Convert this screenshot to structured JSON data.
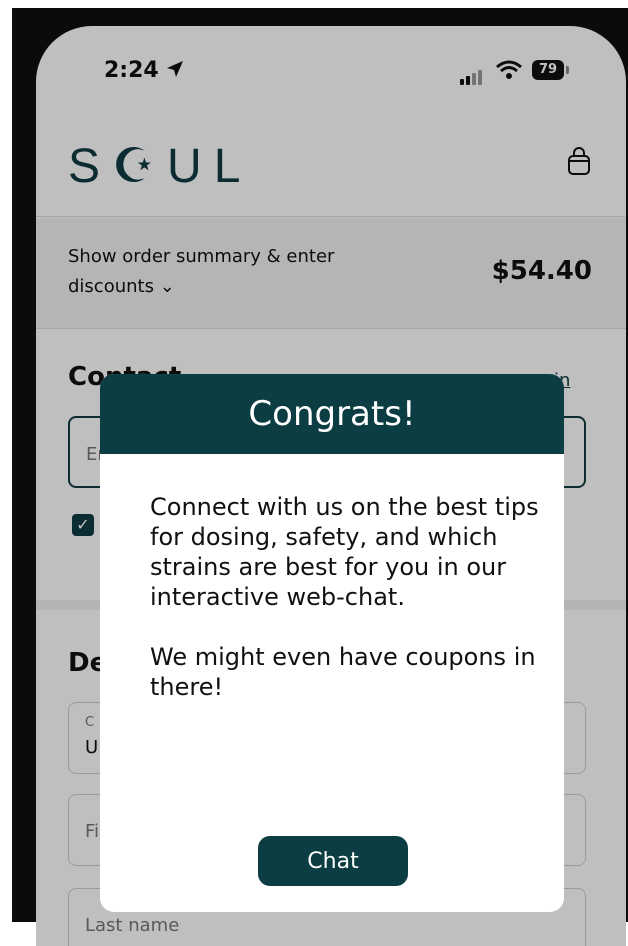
{
  "status": {
    "time": "2:24",
    "battery": "79"
  },
  "brand": {
    "logo": "S☪UL",
    "accent": "#0b3d42"
  },
  "summary": {
    "label": "Show order summary & enter discounts ⌄",
    "price": "$54.40"
  },
  "contact": {
    "heading": "Contact",
    "login_link": "in",
    "email_placeholder": "En"
  },
  "delivery": {
    "heading": "De",
    "country_label": "C",
    "country_value": "U",
    "first_name_placeholder": "Fi",
    "last_name_placeholder": "Last name"
  },
  "modal": {
    "title": "Congrats!",
    "paragraph1": "Connect with us on the best tips for dosing, safety, and which strains are best for you in our interactive web-chat.",
    "paragraph2": "We might even have coupons in there!",
    "button": "Chat"
  }
}
